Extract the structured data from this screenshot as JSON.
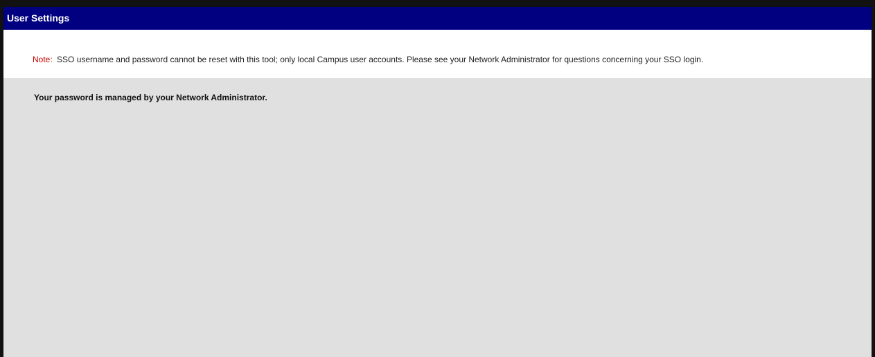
{
  "window": {
    "title": "User Settings",
    "title_bar_color": "#000080"
  },
  "note": {
    "label": "Note:",
    "text": "SSO username and password cannot be reset with this tool; only local Campus user accounts. Please see your Network Administrator for questions concerning your SSO login.",
    "label_color": "#c00000"
  },
  "content": {
    "message": "Your password is managed by your Network Administrator.",
    "background_color": "#e0e0e0"
  }
}
